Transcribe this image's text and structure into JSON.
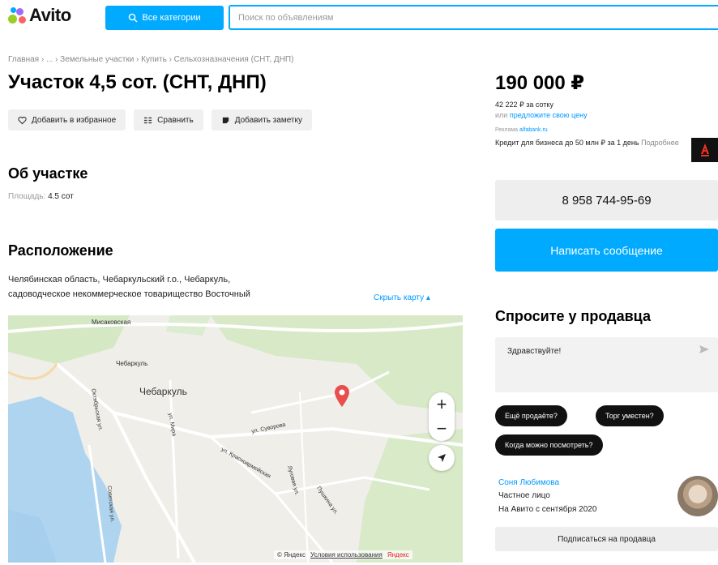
{
  "header": {
    "logo_text": "Avito",
    "categories_label": "Все категории",
    "search_placeholder": "Поиск по объявлениям"
  },
  "breadcrumb": "Главная › ... › Земельные участки › Купить › Сельхозназначения (СНТ, ДНП)",
  "listing": {
    "title": "Участок 4,5 сот. (СНТ, ДНП)",
    "actions": {
      "favorite": "Добавить в избранное",
      "compare": "Сравнить",
      "note": "Добавить заметку"
    },
    "about_heading": "Об участке",
    "area_label": "Площадь:",
    "area_value": "4.5 сот",
    "location_heading": "Расположение",
    "address_line1": "Челябинская область, Чебаркульский г.о., Чебаркуль,",
    "address_line2": "садоводческое некоммерческое товарищество Восточный",
    "hide_map": "Скрыть карту"
  },
  "map": {
    "labels": {
      "city": "Чебаркуль",
      "district": "Чебаркуль",
      "street_top": "Мисаковская",
      "street_oktyabrskaya": "Октябрьская ул.",
      "street_mira": "ул. Мира",
      "street_suvorova": "ул. Суворова",
      "street_krasnoarmeyskaya": "ул. Красноармейская",
      "street_sovetskaya": "Советская ул.",
      "street_pushkina": "Пушкина ул.",
      "street_right": "Луговая ул."
    },
    "zoom_in": "+",
    "zoom_out": "−",
    "footer_copyright": "© Яндекс",
    "footer_terms": "Условия использования",
    "footer_brand": "Яндекс"
  },
  "sidebar": {
    "price": "190 000 ₽",
    "per_sotka": "42 222 ₽ за сотку",
    "offer_prefix": "или",
    "offer_link": "предложите свою цену",
    "ad_label": "Реклама",
    "ad_source": "alfabank.ru",
    "credit_text": "Кредит для бизнеса до 50 млн ₽ за 1 день",
    "credit_more": "Подробнее",
    "phone": "8 958 744-95-69",
    "message_button": "Написать сообщение",
    "ask_heading": "Спросите у продавца",
    "ask_placeholder": "Здравствуйте!",
    "quick_questions": [
      "Ещё продаёте?",
      "Торг уместен?",
      "Когда можно посмотреть?"
    ],
    "seller_name": "Соня Любимова",
    "seller_type": "Частное лицо",
    "seller_since": "На Авито с сентября 2020",
    "subscribe": "Подписаться на продавца"
  },
  "colors": {
    "accent": "#00aaff",
    "pin": "#e84e4e",
    "dark_chip": "#111111"
  }
}
